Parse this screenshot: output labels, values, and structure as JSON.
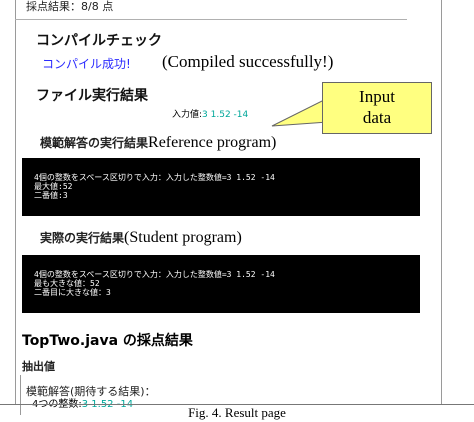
{
  "score": {
    "text": "採点結果：8/8 点"
  },
  "compile": {
    "heading": "コンパイルチェック",
    "status": "コンパイル成功!",
    "note": "(Compiled successfully!)"
  },
  "execution": {
    "heading": "ファイル実行結果",
    "input_label": "入力値:",
    "input_value": "3 1.52 -14"
  },
  "callout": {
    "line1": "Input",
    "line2": "data"
  },
  "reference": {
    "heading": "模範解答の実行結果",
    "note": "Reference program)",
    "output_lines": [
      "4個の整数をスペース区切りで入力：入力した整数値=3 1.52 -14",
      "最大値:52",
      "二番値:3"
    ]
  },
  "student": {
    "heading": "実際の実行結果",
    "note": "(Student program)",
    "output_lines": [
      "4個の整数をスペース区切りで入力：入力した整数値=3 1.52 -14",
      "最も大きな値：52",
      "二番目に大きな値：3"
    ]
  },
  "results": {
    "heading": "TopTwo.java の採点結果",
    "extract_label": "抽出値",
    "ref_label": "模範解答(期待する結果)：",
    "ref_row_label": "4つの整数:",
    "ref_row_value": "3 1.52 -14"
  },
  "caption": {
    "text": "Fig. 4. Result page"
  }
}
